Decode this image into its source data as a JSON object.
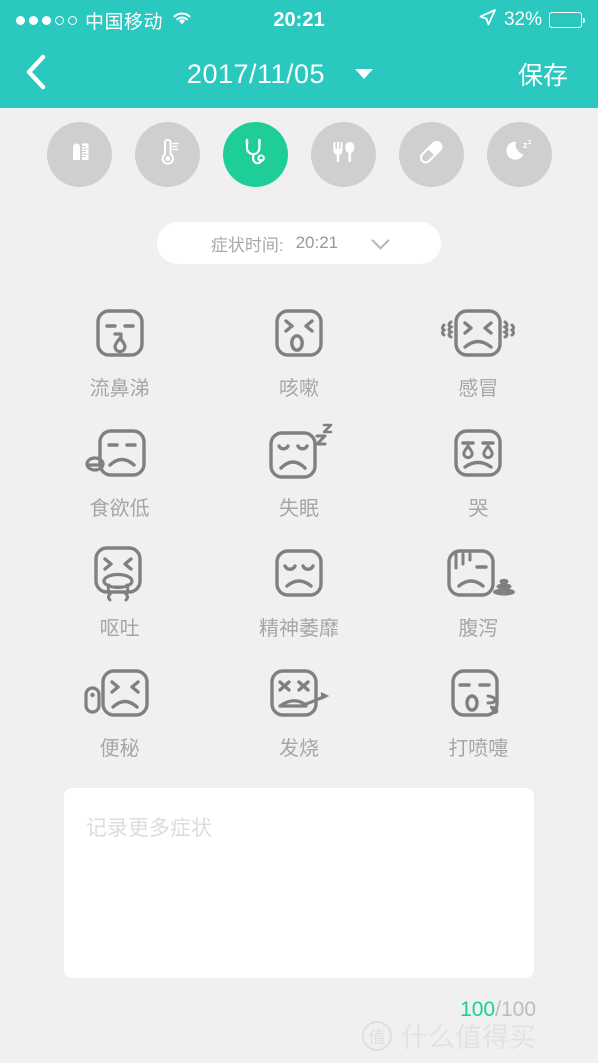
{
  "status_bar": {
    "signal_dots_filled": 3,
    "signal_dots_total": 5,
    "carrier": "中国移动",
    "wifi_icon": "wifi-icon",
    "time": "20:21",
    "location_icon": "location-arrow-icon",
    "battery_percent": "32%",
    "battery_level": 32
  },
  "nav": {
    "back_icon": "chevron-left-icon",
    "title": "2017/11/05",
    "dropdown_icon": "caret-down-icon",
    "save_label": "保存"
  },
  "categories": [
    {
      "name": "growth",
      "icon": "ruler-bottle-icon",
      "active": false
    },
    {
      "name": "temperature",
      "icon": "thermometer-icon",
      "active": false
    },
    {
      "name": "symptoms",
      "icon": "stethoscope-icon",
      "active": true
    },
    {
      "name": "feeding",
      "icon": "fork-spoon-icon",
      "active": false
    },
    {
      "name": "medicine",
      "icon": "pill-icon",
      "active": false
    },
    {
      "name": "sleep",
      "icon": "moon-zzz-icon",
      "active": false
    }
  ],
  "time_selector": {
    "label": "症状时间:",
    "value": "20:21",
    "chevron_icon": "chevron-down-icon"
  },
  "symptoms": [
    {
      "label": "流鼻涕",
      "icon": "runny-nose-face-icon"
    },
    {
      "label": "咳嗽",
      "icon": "cough-face-icon"
    },
    {
      "label": "感冒",
      "icon": "cold-shiver-face-icon"
    },
    {
      "label": "食欲低",
      "icon": "low-appetite-face-icon"
    },
    {
      "label": "失眠",
      "icon": "insomnia-face-icon"
    },
    {
      "label": "哭",
      "icon": "crying-face-icon"
    },
    {
      "label": "呕吐",
      "icon": "vomiting-face-icon"
    },
    {
      "label": "精神萎靡",
      "icon": "listless-face-icon"
    },
    {
      "label": "腹泻",
      "icon": "diarrhea-face-icon"
    },
    {
      "label": "便秘",
      "icon": "constipation-face-icon"
    },
    {
      "label": "发烧",
      "icon": "fever-face-icon"
    },
    {
      "label": "打喷嚏",
      "icon": "sneeze-face-icon"
    }
  ],
  "note": {
    "placeholder": "记录更多症状",
    "value": "",
    "counter_current": "100",
    "counter_max": "/100"
  },
  "watermark": {
    "logo_text": "值",
    "text": "什么值得买"
  },
  "colors": {
    "header_teal": "#2bc8c0",
    "accent_green": "#1ecd97",
    "page_background": "#f0f0f0",
    "icon_gray": "#808080",
    "label_gray": "#a6a6a6"
  }
}
